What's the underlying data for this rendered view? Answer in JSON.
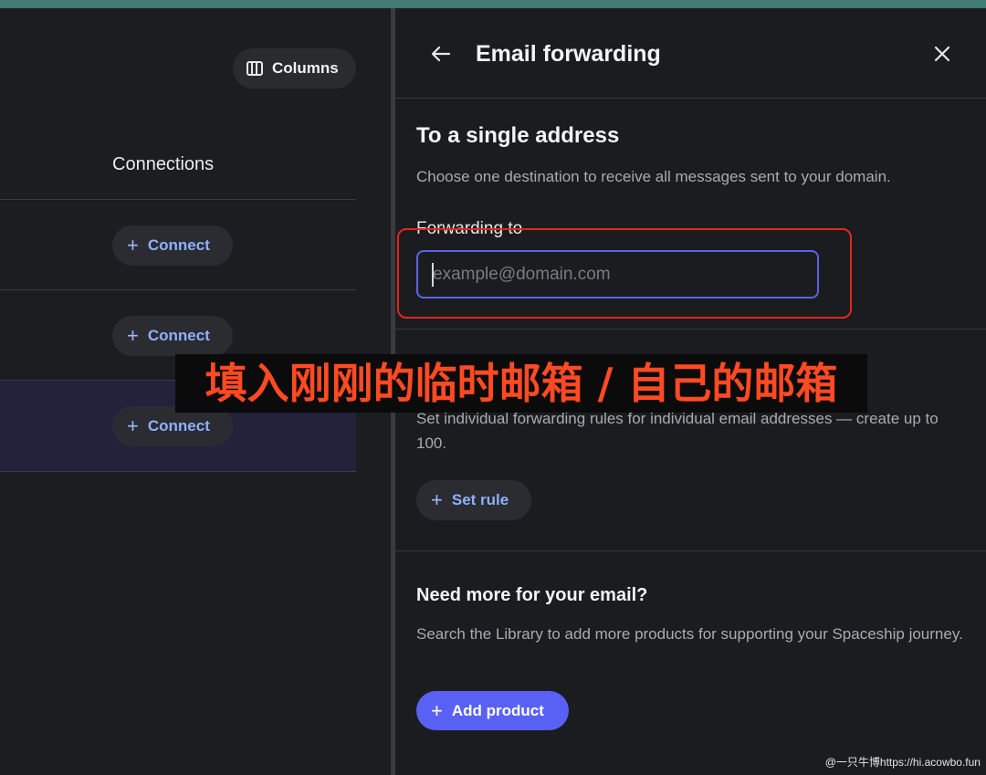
{
  "left": {
    "columns_label": "Columns",
    "connections_heading": "Connections",
    "connect_label": "Connect"
  },
  "panel": {
    "title": "Email forwarding",
    "single": {
      "heading": "To a single address",
      "description": "Choose one destination to receive all messages sent to your domain.",
      "field_label": "Forwarding to",
      "field_value": "",
      "field_placeholder": "example@domain.com"
    },
    "rules": {
      "description": "Set individual forwarding rules for individual email addresses — create up to 100.",
      "button_label": "Set rule"
    },
    "more": {
      "heading": "Need more for your email?",
      "description": "Search the Library to add more products for supporting your Spaceship journey.",
      "button_label": "Add product"
    }
  },
  "overlay": {
    "text": "填入刚刚的临时邮箱 / 自己的邮箱"
  },
  "watermark": {
    "text": "@一只牛博https://hi.acowbo.fun"
  },
  "colors": {
    "accent": "#5961f5",
    "link": "#8fb0ff",
    "highlight": "#e0281f",
    "annotation": "#ff4a23"
  },
  "icons": {
    "columns": "columns-icon",
    "plus": "plus-icon",
    "back": "arrow-left-icon",
    "close": "close-icon"
  }
}
